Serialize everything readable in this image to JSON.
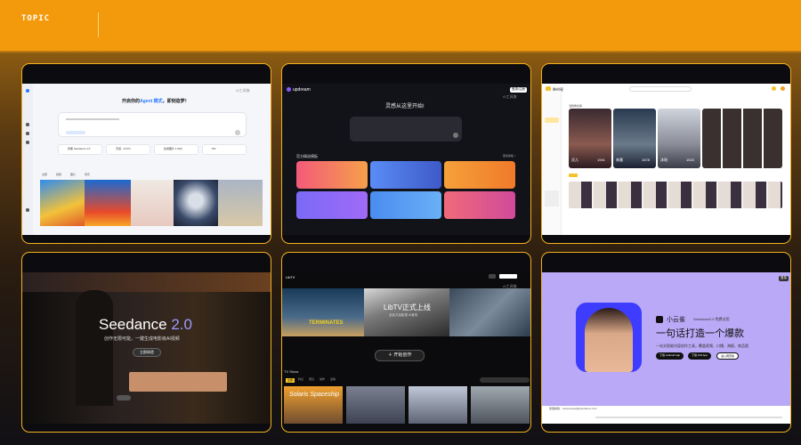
{
  "header": {
    "topic_label": "TOPIC"
  },
  "card1": {
    "title_prefix": "开启你的",
    "title_highlight": "Agent 模式",
    "title_suffix": "，即刻造梦！",
    "logo": "AI工具集",
    "chips": [
      "智能 Seedance 2.0",
      "灵感 · AI Pro",
      "生成图片 1.5(0)",
      "MV"
    ],
    "tabs": [
      "全部",
      "视频",
      "图片",
      "音乐"
    ]
  },
  "card2": {
    "brand": "updream",
    "login": "登录/注册",
    "logo": "AI工具集",
    "headline": "灵感从这里开始!",
    "section": "官方精选模板",
    "more": "更多模板 >"
  },
  "card3": {
    "brand": "融创星",
    "top_tag": "漫剧角色库",
    "cards": [
      {
        "name": "灵儿",
        "num": "1941"
      },
      {
        "name": "林墨",
        "num": "1678"
      },
      {
        "name": "沐瑶",
        "num": "1515"
      },
      {
        "name": "",
        "num": ""
      }
    ]
  },
  "card4": {
    "logo": "AI工具集",
    "title_main": "Seedance",
    "title_version": "2.0",
    "tagline": "创作无限可能，一键生成电影级AI视频",
    "cta": "立即体验"
  },
  "card5": {
    "brand": "LibTV",
    "logo": "AI工具集",
    "banner": "LibTV正式上线",
    "banner_sub": "全民共创影视 AI宣传",
    "cta": "开始创作",
    "section": "TV Show",
    "tags": [
      "全部",
      "科幻",
      "奇幻",
      "动作",
      "爱情"
    ],
    "poster_title": "Solaris Spaceship",
    "left_title": "TERMINATES"
  },
  "card6": {
    "brand": "小云雀",
    "model_label": "Seedance2.0 免费试用",
    "headline": "一句话打造一个爆款",
    "sub": "一站式智能内容创作工具，覆盖视频、口播、海报、商品图",
    "buttons": [
      "下载 Android App",
      "下载 iOS App",
      "进入网页版"
    ],
    "login": "登录",
    "footer": "客服邮箱：xiaoyunque@bytedance.com",
    "colors": {
      "bg": "#b9a9f6",
      "accent": "#3e3cff"
    }
  }
}
